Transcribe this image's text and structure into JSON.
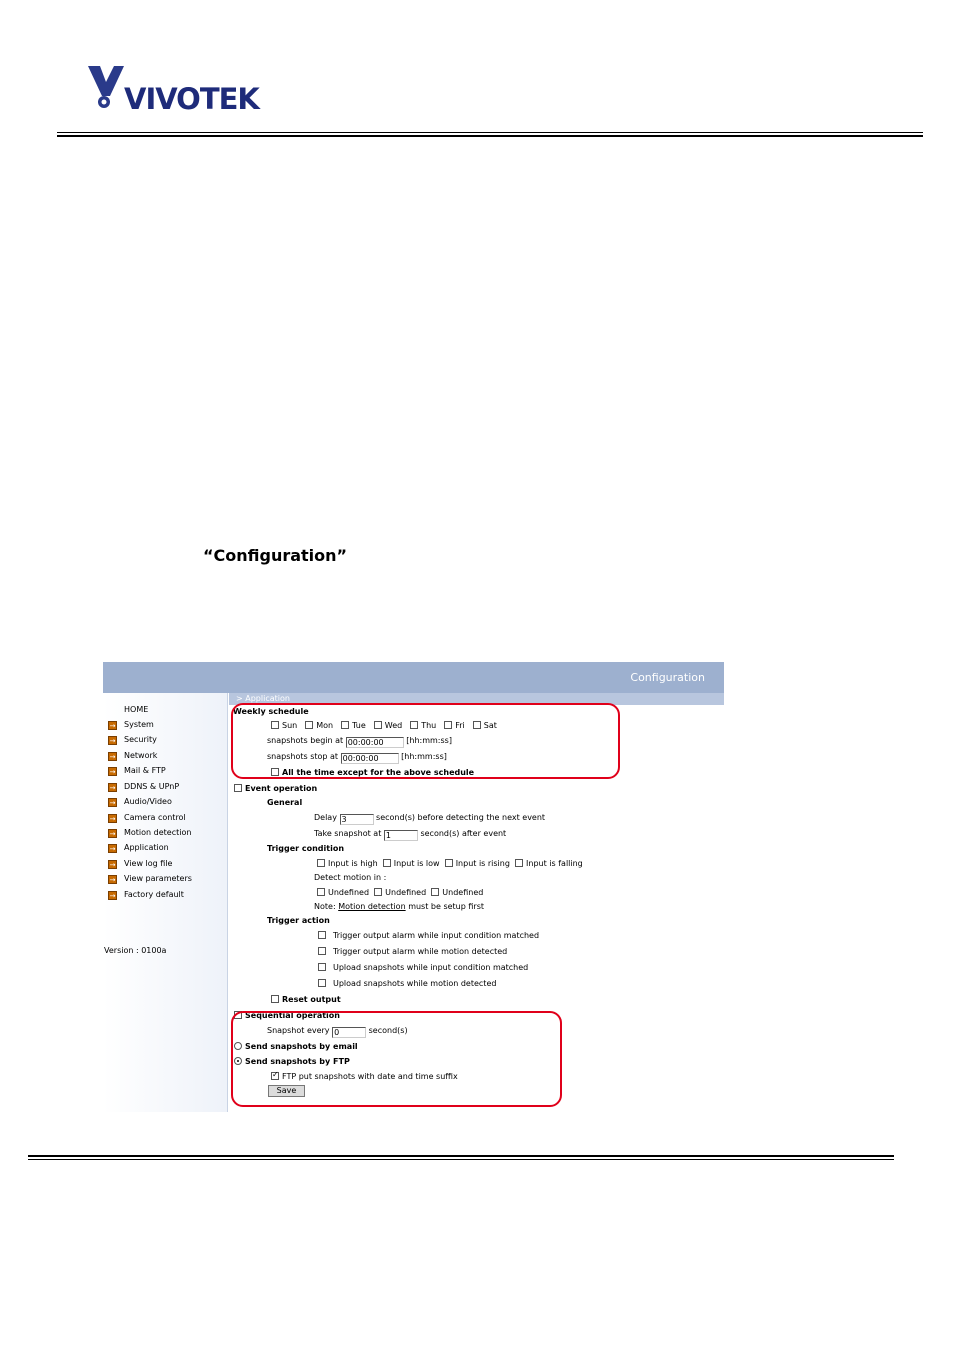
{
  "brand": {
    "name": "VIVOTEK"
  },
  "document": {
    "heading": "“Configuration”"
  },
  "ui": {
    "header_title": "Configuration",
    "breadcrumb": "> Application",
    "sidebar": {
      "home": "HOME",
      "items": [
        "System",
        "Security",
        "Network",
        "Mail & FTP",
        "DDNS & UPnP",
        "Audio/Video",
        "Camera control",
        "Motion detection",
        "Application",
        "View log file",
        "View parameters",
        "Factory default"
      ],
      "version": "Version : 0100a"
    },
    "weekly": {
      "title": "Weekly schedule",
      "days": [
        "Sun",
        "Mon",
        "Tue",
        "Wed",
        "Thu",
        "Fri",
        "Sat"
      ],
      "begin_label": "snapshots begin at",
      "begin_value": "00:00:00",
      "stop_label": "snapshots stop at",
      "stop_value": "00:00:00",
      "format": "[hh:mm:ss]",
      "all_time": "All the time except for the above schedule"
    },
    "event": {
      "title": "Event operation",
      "general": "General",
      "delay_label": "Delay",
      "delay_value": "3",
      "delay_suffix": "second(s) before detecting the next event",
      "take_label": "Take snapshot at",
      "take_value": "1",
      "take_suffix": "second(s) after event",
      "trigger_condition": "Trigger condition",
      "inputs": [
        "Input is high",
        "Input is low",
        "Input is rising",
        "Input is falling"
      ],
      "detect_label": "Detect motion in :",
      "undefined": [
        "Undefined",
        "Undefined",
        "Undefined"
      ],
      "note_prefix": "Note:",
      "note_link": "Motion detection",
      "note_suffix": "must be setup first",
      "trigger_action": "Trigger action",
      "actions": [
        "Trigger output alarm while input condition matched",
        "Trigger output alarm while motion detected",
        "Upload snapshots while input condition matched",
        "Upload snapshots while motion detected"
      ],
      "reset": "Reset output"
    },
    "sequential": {
      "title": "Sequential operation",
      "every_label": "Snapshot every",
      "every_value": "0",
      "every_suffix": "second(s)"
    },
    "send_email": "Send snapshots by email",
    "send_ftp": "Send snapshots by FTP",
    "ftp_suffix": "FTP put snapshots with date and time suffix",
    "save": "Save"
  },
  "colors": {
    "header": "#9db0cf",
    "highlight_box": "#e0001a"
  }
}
